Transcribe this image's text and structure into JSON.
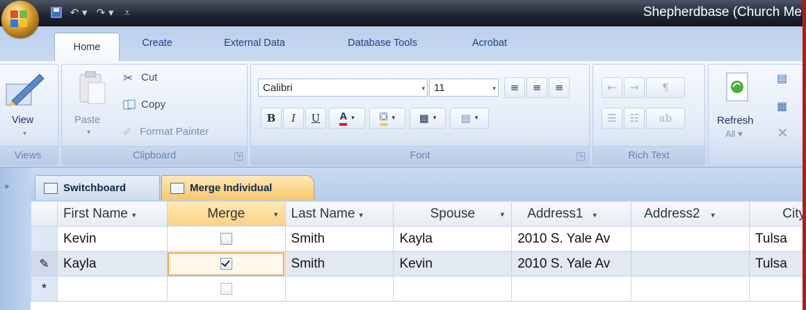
{
  "app": {
    "title": "Shepherdbase (Church Me"
  },
  "qat": {
    "save_icon": "save-icon",
    "undo_icon": "undo-icon",
    "redo_icon": "redo-icon",
    "customize_icon": "customize-icon"
  },
  "ribbon": {
    "tabs": [
      {
        "label": "Home",
        "active": true
      },
      {
        "label": "Create"
      },
      {
        "label": "External Data"
      },
      {
        "label": "Database Tools"
      },
      {
        "label": "Acrobat"
      }
    ],
    "groups": {
      "views": {
        "label": "Views",
        "view_button": "View"
      },
      "clipboard": {
        "label": "Clipboard",
        "paste": "Paste",
        "cut": "Cut",
        "copy": "Copy",
        "format_painter": "Format Painter"
      },
      "font": {
        "label": "Font",
        "font_name": "Calibri",
        "font_size": "11",
        "bold": "B",
        "italic": "I",
        "underline": "U",
        "font_color": "A"
      },
      "rich_text": {
        "label": "Rich Text"
      },
      "records": {
        "refresh": "Refresh",
        "refresh_all": "All"
      }
    }
  },
  "document_tabs": [
    {
      "label": "Switchboard",
      "active": false
    },
    {
      "label": "Merge Individual",
      "active": true
    }
  ],
  "datasheet": {
    "columns": [
      "First Name",
      "Merge",
      "Last Name",
      "Spouse",
      "Address1",
      "Address2",
      "City"
    ],
    "rows": [
      {
        "first_name": "Kevin",
        "merge": false,
        "last_name": "Smith",
        "spouse": "Kayla",
        "address1": "2010 S. Yale Av",
        "address2": "",
        "city": "Tulsa"
      },
      {
        "first_name": "Kayla",
        "merge": true,
        "last_name": "Smith",
        "spouse": "Kevin",
        "address1": "2010 S. Yale Av",
        "address2": "",
        "city": "Tulsa",
        "editing": true
      }
    ],
    "new_record_marker": "*",
    "edit_marker": "pencil-icon"
  },
  "colors": {
    "accent": "#f8c76a",
    "ribbon_text": "#15428b",
    "window_border": "#b01c1c"
  }
}
